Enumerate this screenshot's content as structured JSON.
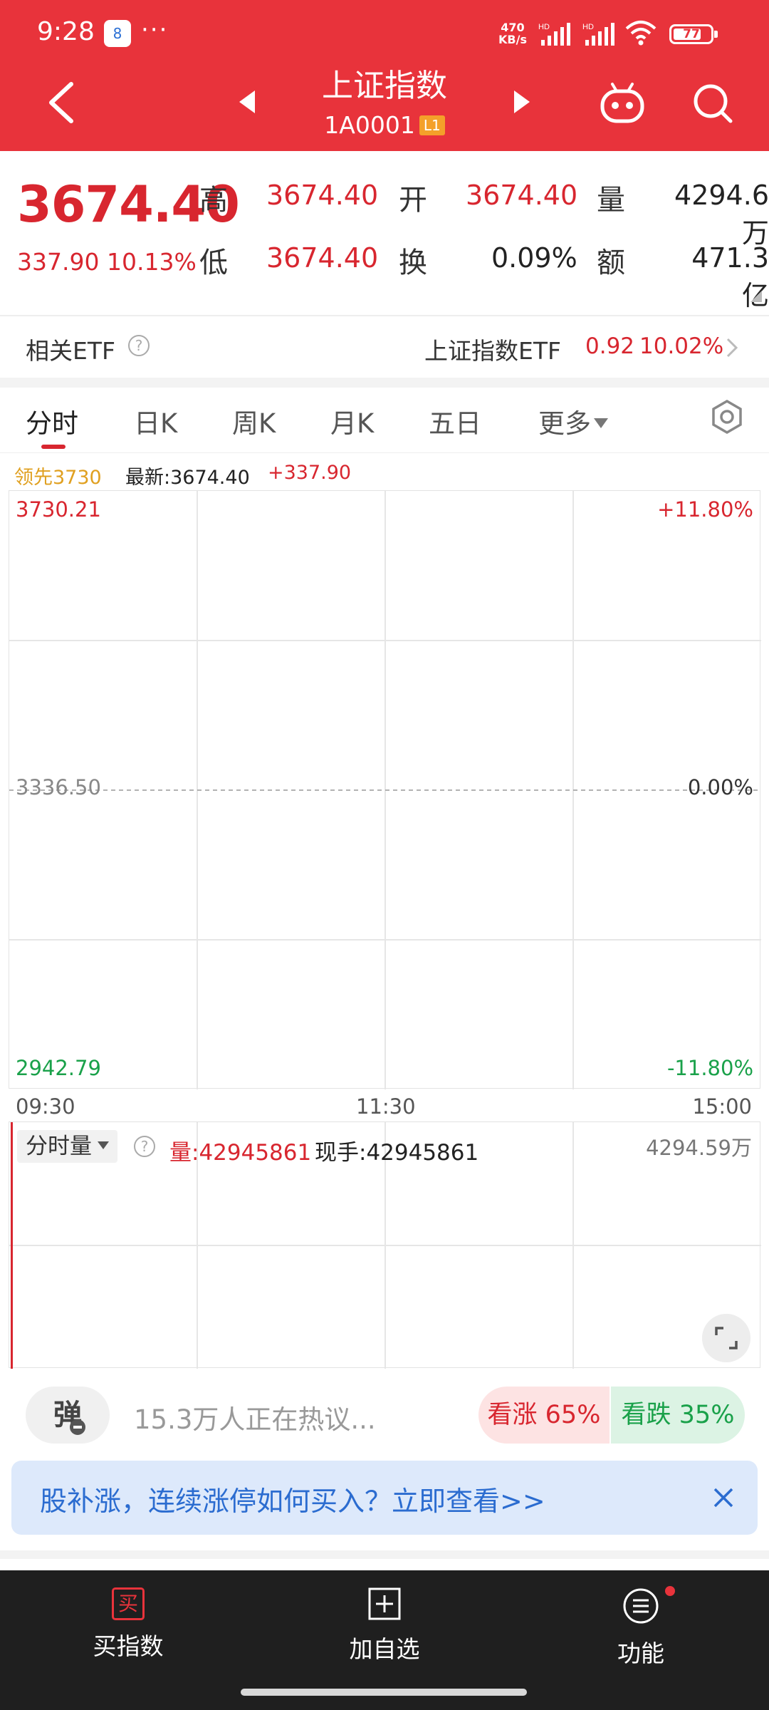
{
  "status_bar": {
    "time": "9:28",
    "notif_badge": "8",
    "dots": "···",
    "net_speed_value": "470",
    "net_speed_unit": "KB/s",
    "hd1": "HD",
    "hd2": "HD",
    "battery": "77"
  },
  "header": {
    "title": "上证指数",
    "code": "1A0001",
    "level_badge": "L1",
    "icons": [
      "back-icon",
      "prev-arrow-icon",
      "next-arrow-icon",
      "robot-icon",
      "search-icon"
    ]
  },
  "quote": {
    "price": "3674.40",
    "change": "337.90",
    "change_pct": "10.13%",
    "high_label": "高",
    "high": "3674.40",
    "open_label": "开",
    "open": "3674.40",
    "volume_label": "量",
    "volume": "4294.6万",
    "low_label": "低",
    "low": "3674.40",
    "turnover_label": "换",
    "turnover": "0.09%",
    "amount_label": "额",
    "amount": "471.3亿"
  },
  "etf": {
    "label": "相关ETF",
    "help": "?",
    "name": "上证指数ETF",
    "price": "0.92",
    "pct": "10.02%"
  },
  "tabs": {
    "items": [
      "分时",
      "日K",
      "周K",
      "月K",
      "五日",
      "更多"
    ],
    "active": "分时"
  },
  "chart_info": {
    "leader": "领先3730",
    "latest": "最新:3674.40",
    "change": "+337.90"
  },
  "chart_data": {
    "type": "line",
    "title": "",
    "x_ticks": [
      "09:30",
      "11:30",
      "15:00"
    ],
    "y_left": [
      "3730.21",
      "3336.50",
      "2942.79"
    ],
    "y_right": [
      "+11.80%",
      "0.00%",
      "-11.80%"
    ],
    "ylim": [
      2942.79,
      3730.21
    ],
    "baseline": 3336.5,
    "series": [],
    "grid": true
  },
  "volume": {
    "selector": "分时量",
    "help": "?",
    "vol_label": "量:42945861",
    "hand_label": "现手:42945861",
    "max": "4294.59万"
  },
  "discuss": {
    "danmu": "弹",
    "text": "15.3万人正在热议...",
    "bull": "看涨 65%",
    "bear": "看跌 35%"
  },
  "banner": {
    "text": "股补涨，连续涨停如何买入？立即查看>>"
  },
  "bottom_bar": {
    "buy_icon": "买",
    "buy": "买指数",
    "add": "加自选",
    "func": "功能"
  },
  "colors": {
    "brand_red": "#e8333b",
    "up": "#d8262f",
    "down": "#1aa14a",
    "leader": "#e0a020"
  }
}
